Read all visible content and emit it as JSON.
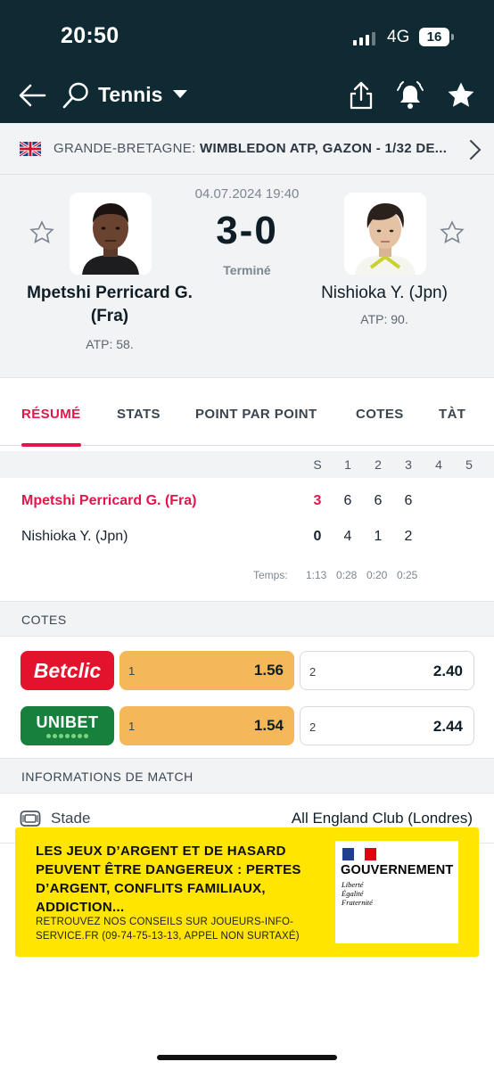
{
  "status_bar": {
    "time": "20:50",
    "network": "4G",
    "battery": "16"
  },
  "nav": {
    "title": "Tennis",
    "icons": [
      "back-arrow-icon",
      "tennis-racket-icon",
      "dropdown-caret-icon",
      "share-icon",
      "alarm-bell-icon",
      "favorite-star-icon"
    ]
  },
  "league": {
    "country": "GRANDE-BRETAGNE:",
    "name": "WIMBLEDON ATP, GAZON - 1/32 DE..."
  },
  "match": {
    "date": "04.07.2024 19:40",
    "score": "3-0",
    "status": "Terminé",
    "home": {
      "name_line1": "Mpetshi Perricard G.",
      "name_line2": "(Fra)",
      "rank": "ATP: 58."
    },
    "away": {
      "name": "Nishioka Y. (Jpn)",
      "rank": "ATP: 90."
    }
  },
  "tabs": [
    {
      "label": "RÉSUMÉ",
      "active": true
    },
    {
      "label": "STATS",
      "active": false
    },
    {
      "label": "POINT PAR POINT",
      "active": false
    },
    {
      "label": "COTES",
      "active": false
    },
    {
      "label": "TÀT",
      "active": false
    }
  ],
  "scoreboard": {
    "headers": [
      "S",
      "1",
      "2",
      "3",
      "4",
      "5"
    ],
    "rows": [
      {
        "name": "Mpetshi Perricard G. (Fra)",
        "sets": "3",
        "games": [
          "6",
          "6",
          "6"
        ]
      },
      {
        "name": "Nishioka Y. (Jpn)",
        "sets": "0",
        "games": [
          "4",
          "1",
          "2"
        ]
      }
    ],
    "time_label": "Temps:",
    "times": [
      "1:13",
      "0:28",
      "0:20",
      "0:25"
    ]
  },
  "odds": {
    "section_title": "COTES",
    "bookmakers": [
      {
        "name": "Betclic",
        "home_label": "1",
        "home_odd": "1.56",
        "away_label": "2",
        "away_odd": "2.40",
        "color": "#e3132b"
      },
      {
        "name": "UNIBET",
        "home_label": "1",
        "home_odd": "1.54",
        "away_label": "2",
        "away_odd": "2.44",
        "color": "#18803d"
      }
    ]
  },
  "match_info": {
    "section_title": "INFORMATIONS DE MATCH",
    "stadium_label": "Stade",
    "stadium_value": "All England Club (Londres)"
  },
  "ad": {
    "headline": "LES JEUX D’ARGENT ET DE HASARD PEUVENT ÊTRE DANGEREUX : PERTES D’ARGENT, CONFLITS FAMILIAUX, ADDICTION...",
    "subtext": "RETROUVEZ NOS CONSEILS SUR JOUEURS-INFO-SERVICE.FR (09-74-75-13-13, APPEL NON SURTAXÉ)",
    "gov_title": "GOUVERNEMENT",
    "gov_motto": [
      "Liberté",
      "Égalité",
      "Fraternité"
    ]
  },
  "colors": {
    "header_bg": "#0f2a33",
    "accent": "#e3154a",
    "odd_highlight": "#f4b85b",
    "ad_bg": "#ffe500"
  }
}
